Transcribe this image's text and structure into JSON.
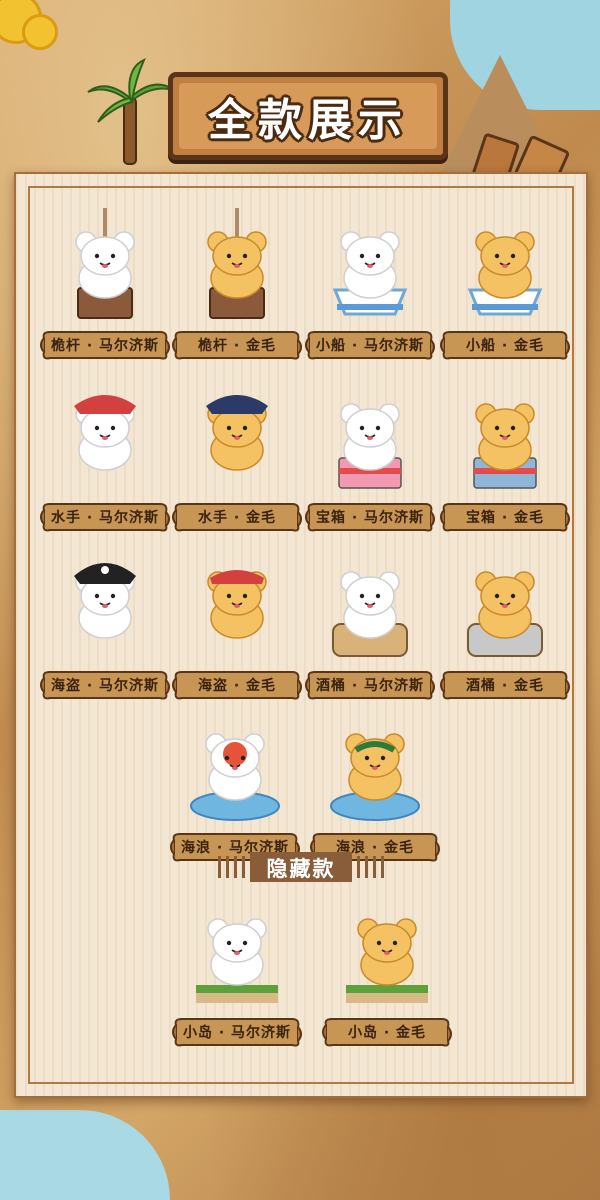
{
  "title": "全款展示",
  "hidden_section_label": "隐藏款",
  "colors": {
    "parchment": "#f3e6d2",
    "wood": "#c27f43",
    "scroll": "#c79554",
    "ink": "#3a2210",
    "white_bear": "#ffffff",
    "golden_bear": "#f5c263"
  },
  "items": [
    {
      "label": "桅杆 · 马尔济斯",
      "figure": "white-dog-on-mast-icon"
    },
    {
      "label": "桅杆 · 金毛",
      "figure": "golden-dog-on-mast-icon"
    },
    {
      "label": "小船 · 马尔济斯",
      "figure": "white-dog-in-boat-icon"
    },
    {
      "label": "小船 · 金毛",
      "figure": "golden-dog-in-boat-icon"
    },
    {
      "label": "水手 · 马尔济斯",
      "figure": "white-dog-sailor-icon"
    },
    {
      "label": "水手 · 金毛",
      "figure": "golden-dog-sailor-icon"
    },
    {
      "label": "宝箱 · 马尔济斯",
      "figure": "white-dog-treasure-chest-icon"
    },
    {
      "label": "宝箱 · 金毛",
      "figure": "golden-dog-treasure-chest-icon"
    },
    {
      "label": "海盗 · 马尔济斯",
      "figure": "white-dog-pirate-icon"
    },
    {
      "label": "海盗 · 金毛",
      "figure": "golden-dog-pirate-icon"
    },
    {
      "label": "酒桶 · 马尔济斯",
      "figure": "white-dog-barrel-icon"
    },
    {
      "label": "酒桶 · 金毛",
      "figure": "golden-dog-barrel-icon"
    },
    {
      "label": "海浪 · 马尔济斯",
      "figure": "white-dog-wave-icon"
    },
    {
      "label": "海浪 · 金毛",
      "figure": "golden-dog-wave-icon"
    }
  ],
  "hidden_items": [
    {
      "label": "小岛 · 马尔济斯",
      "figure": "white-dog-island-icon"
    },
    {
      "label": "小岛 · 金毛",
      "figure": "golden-dog-island-icon"
    }
  ]
}
